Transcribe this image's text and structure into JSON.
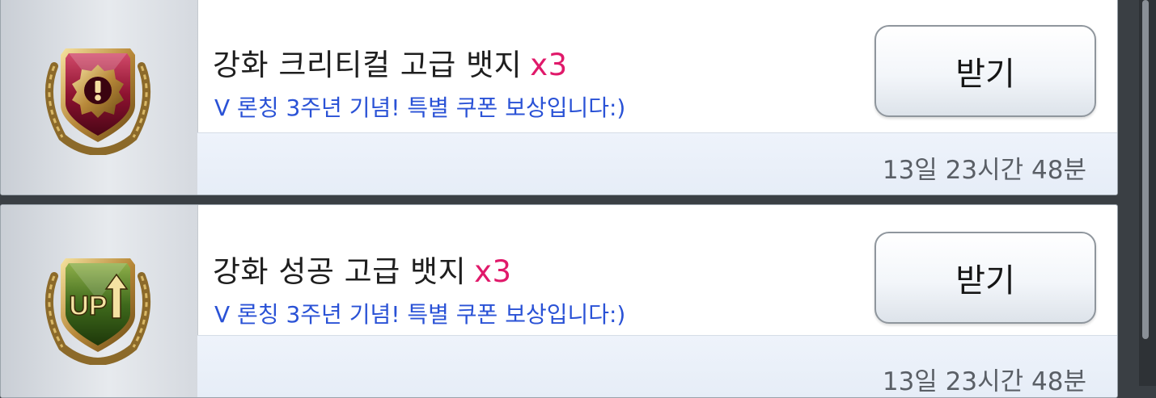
{
  "rewards": [
    {
      "badge_icon": "critical-badge-icon",
      "name": "강화 크리티컬 고급 뱃지",
      "qty": "x3",
      "message": "V 론칭 3주년 기념! 특별 쿠폰 보상입니다:)",
      "time_left": "13일 23시간 48분",
      "claim_label": "받기"
    },
    {
      "badge_icon": "success-up-badge-icon",
      "name": "강화 성공 고급 뱃지",
      "qty": "x3",
      "message": "V 론칭 3주년 기념! 특별 쿠폰 보상입니다:)",
      "time_left": "13일 23시간 48분",
      "claim_label": "받기",
      "badge_text": "UP"
    }
  ],
  "colors": {
    "quantity": "#e0196a",
    "message": "#2a52d6",
    "critical_badge": "#8e1230",
    "success_badge": "#3f6a1c"
  }
}
